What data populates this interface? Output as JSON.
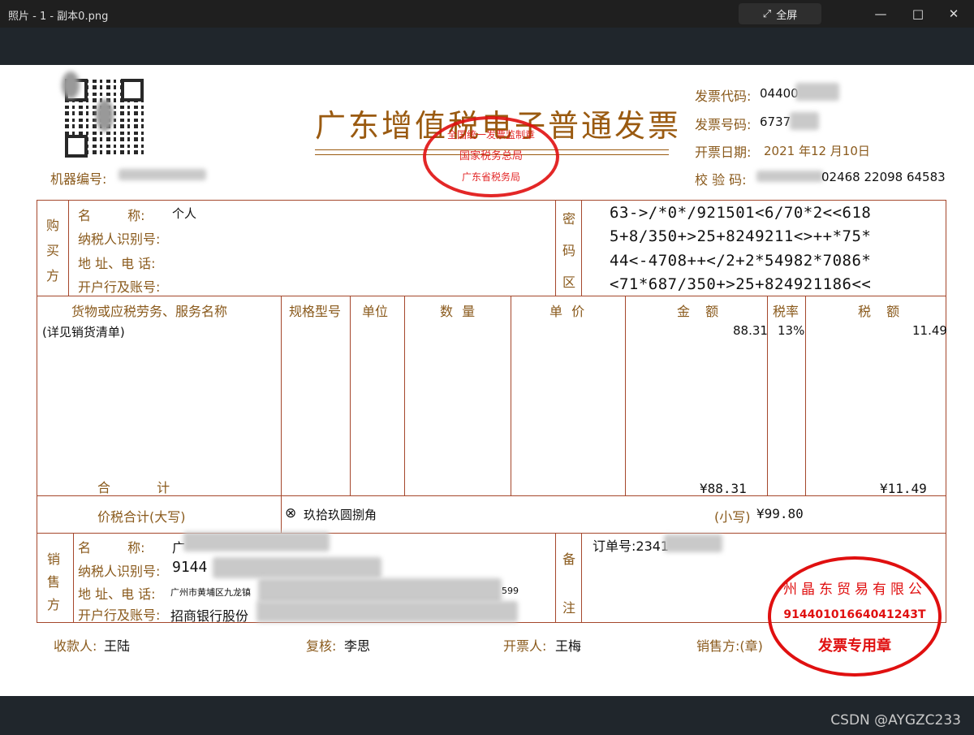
{
  "window": {
    "title": "照片 - 1 - 副本0.png",
    "fullscreen_label": "全屏",
    "minimize_icon": "—",
    "maximize_icon": "□",
    "close_icon": "✕"
  },
  "watermark": "CSDN @AYGZC233",
  "invoice": {
    "title": "广东增值税电子普通发票",
    "machine_no_label": "机器编号:",
    "code_label": "发票代码:",
    "code_value": "04400",
    "number_label": "发票号码:",
    "number_value": "6737",
    "date_label": "开票日期:",
    "date_value": "2021 年12 月10日",
    "check_label": "校 验 码:",
    "check_value": "02468 22098 64583",
    "official_stamp": {
      "line1": "全国统一发票监制章",
      "line2": "国家税务总局",
      "line3": "广东省税务局"
    },
    "buyer": {
      "side_label": [
        "购",
        "买",
        "方"
      ],
      "name_label": "名 称:",
      "name_value": "个人",
      "tax_id_label": "纳税人识别号:",
      "address_label": "地 址、电 话:",
      "bank_label": "开户行及账号:"
    },
    "cipher": {
      "side_label": [
        "密",
        "码",
        "区"
      ],
      "lines": [
        "63->/*0*/921501<6/70*2<<618",
        "5+8/350+>25+8249211<>++*75*",
        "44<-4708++</2+2*54982*7086*",
        "<71*687/350+>25+824921186<<"
      ]
    },
    "items": {
      "headers": {
        "name": "货物或应税劳务、服务名称",
        "spec": "规格型号",
        "unit": "单位",
        "qty": "数 量",
        "price": "单 价",
        "amount": "金 额",
        "rate": "税率",
        "tax": "税 额"
      },
      "row": {
        "name": "(详见销货清单)",
        "amount": "88.31",
        "rate": "13%",
        "tax": "11.49"
      },
      "total_label": "合 计",
      "total_amount": "¥88.31",
      "total_tax": "¥11.49"
    },
    "grand_total": {
      "label": "价税合计(大写)",
      "words": "玖拾玖圆捌角",
      "small_label": "(小写)",
      "small_value": "¥99.80"
    },
    "seller": {
      "side_label": [
        "销",
        "售",
        "方"
      ],
      "name_label": "名 称:",
      "name_value": "广",
      "tax_id_label": "纳税人识别号:",
      "tax_id_value": "9144",
      "address_label": "地 址、电 话:",
      "address_value": "广州市黄埔区九龙镇",
      "address_tail": "599",
      "bank_label": "开户行及账号:",
      "bank_value": "招商银行股份"
    },
    "remarks": {
      "side_label": [
        "备",
        "注"
      ],
      "order_label": "订单号:2341"
    },
    "seller_stamp": {
      "line1": "州晶东贸易有限公",
      "tax_id": "91440101664041243T",
      "line3": "发票专用章"
    },
    "footer": {
      "payee_label": "收款人:",
      "payee": "王陆",
      "reviewer_label": "复核:",
      "reviewer": "李思",
      "issuer_label": "开票人:",
      "issuer": "王梅",
      "seller_label": "销售方:(章)"
    }
  }
}
